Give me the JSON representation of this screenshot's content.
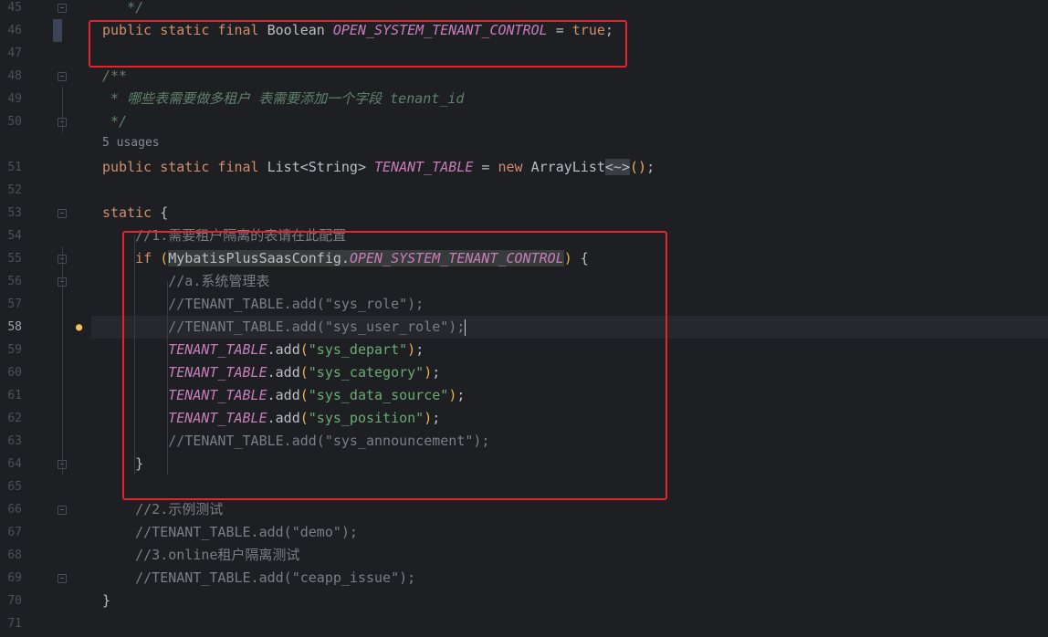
{
  "editor": {
    "current_line": "58",
    "usages_label": "5 usages",
    "lines": [
      {
        "no": "45",
        "tokens": [
          {
            "t": "   */",
            "c": "doc"
          }
        ]
      },
      {
        "no": "46",
        "tokens": [
          {
            "t": "public static final ",
            "c": "kw"
          },
          {
            "t": "Boolean ",
            "c": "type"
          },
          {
            "t": "OPEN_SYSTEM_TENANT_CONTROL",
            "c": "const"
          },
          {
            "t": " = ",
            "c": "type"
          },
          {
            "t": "true",
            "c": "kw"
          },
          {
            "t": ";",
            "c": "type"
          }
        ]
      },
      {
        "no": "47",
        "tokens": []
      },
      {
        "no": "48",
        "tokens": [
          {
            "t": "/**",
            "c": "doc"
          }
        ]
      },
      {
        "no": "49",
        "tokens": [
          {
            "t": " * 哪些表需要做多租户 表需要添加一个字段 ",
            "c": "doc"
          },
          {
            "t": "tenant_id",
            "c": "doc"
          }
        ]
      },
      {
        "no": "50",
        "tokens": [
          {
            "t": " */",
            "c": "doc"
          }
        ]
      },
      {
        "no": "51",
        "tokens": [
          {
            "t": "public static final ",
            "c": "kw"
          },
          {
            "t": "List",
            "c": "type"
          },
          {
            "t": "<",
            "c": "type"
          },
          {
            "t": "String",
            "c": "type"
          },
          {
            "t": "> ",
            "c": "type"
          },
          {
            "t": "TENANT_TABLE",
            "c": "const"
          },
          {
            "t": " = ",
            "c": "type"
          },
          {
            "t": "new ",
            "c": "kw"
          },
          {
            "t": "ArrayList",
            "c": "type"
          },
          {
            "t": "<~>",
            "c": "diamond"
          },
          {
            "t": "()",
            "c": "brace-y"
          },
          {
            "t": ";",
            "c": "type"
          }
        ]
      },
      {
        "no": "52",
        "tokens": []
      },
      {
        "no": "53",
        "tokens": [
          {
            "t": "static ",
            "c": "kw"
          },
          {
            "t": "{",
            "c": "type"
          }
        ]
      },
      {
        "no": "54",
        "tokens": [
          {
            "t": "    //1.需要租户隔离的表请在此配置",
            "c": "cmt"
          }
        ]
      },
      {
        "no": "55",
        "tokens": [
          {
            "t": "    ",
            "c": "type"
          },
          {
            "t": "if ",
            "c": "kw"
          },
          {
            "t": "(",
            "c": "brace-y"
          },
          {
            "t": "MybatisPlusSaasConfig",
            "c": "ref-hl"
          },
          {
            "t": ".",
            "c": "ref-hl"
          },
          {
            "t": "OPEN_SYSTEM_TENANT_CONTROL",
            "c": "ref-hl const"
          },
          {
            "t": ")",
            "c": "brace-y"
          },
          {
            "t": " {",
            "c": "type"
          }
        ]
      },
      {
        "no": "56",
        "tokens": [
          {
            "t": "        //a.系统管理表",
            "c": "cmt"
          }
        ]
      },
      {
        "no": "57",
        "tokens": [
          {
            "t": "        //TENANT_TABLE.add(\"sys_role\");",
            "c": "cmt"
          }
        ]
      },
      {
        "no": "58",
        "tokens": [
          {
            "t": "        //TENANT_TABLE.add(\"sys_user_role\");",
            "c": "cmt"
          }
        ]
      },
      {
        "no": "59",
        "tokens": [
          {
            "t": "        ",
            "c": "type"
          },
          {
            "t": "TENANT_TABLE",
            "c": "const"
          },
          {
            "t": ".add",
            "c": "type"
          },
          {
            "t": "(",
            "c": "brace-y"
          },
          {
            "t": "\"sys_depart\"",
            "c": "str"
          },
          {
            "t": ")",
            "c": "brace-y"
          },
          {
            "t": ";",
            "c": "type"
          }
        ]
      },
      {
        "no": "60",
        "tokens": [
          {
            "t": "        ",
            "c": "type"
          },
          {
            "t": "TENANT_TABLE",
            "c": "const"
          },
          {
            "t": ".add",
            "c": "type"
          },
          {
            "t": "(",
            "c": "brace-y"
          },
          {
            "t": "\"sys_category\"",
            "c": "str"
          },
          {
            "t": ")",
            "c": "brace-y"
          },
          {
            "t": ";",
            "c": "type"
          }
        ]
      },
      {
        "no": "61",
        "tokens": [
          {
            "t": "        ",
            "c": "type"
          },
          {
            "t": "TENANT_TABLE",
            "c": "const"
          },
          {
            "t": ".add",
            "c": "type"
          },
          {
            "t": "(",
            "c": "brace-y"
          },
          {
            "t": "\"sys_data_source\"",
            "c": "str"
          },
          {
            "t": ")",
            "c": "brace-y"
          },
          {
            "t": ";",
            "c": "type"
          }
        ]
      },
      {
        "no": "62",
        "tokens": [
          {
            "t": "        ",
            "c": "type"
          },
          {
            "t": "TENANT_TABLE",
            "c": "const"
          },
          {
            "t": ".add",
            "c": "type"
          },
          {
            "t": "(",
            "c": "brace-y"
          },
          {
            "t": "\"sys_position\"",
            "c": "str"
          },
          {
            "t": ")",
            "c": "brace-y"
          },
          {
            "t": ";",
            "c": "type"
          }
        ]
      },
      {
        "no": "63",
        "tokens": [
          {
            "t": "        //TENANT_TABLE.add(\"sys_announcement\");",
            "c": "cmt"
          }
        ]
      },
      {
        "no": "64",
        "tokens": [
          {
            "t": "    }",
            "c": "type"
          }
        ]
      },
      {
        "no": "65",
        "tokens": []
      },
      {
        "no": "66",
        "tokens": [
          {
            "t": "    //2.示例测试",
            "c": "cmt"
          }
        ]
      },
      {
        "no": "67",
        "tokens": [
          {
            "t": "    //TENANT_TABLE.add(\"demo\");",
            "c": "cmt"
          }
        ]
      },
      {
        "no": "68",
        "tokens": [
          {
            "t": "    //3.online租户隔离测试",
            "c": "cmt"
          }
        ]
      },
      {
        "no": "69",
        "tokens": [
          {
            "t": "    //TENANT_TABLE.add(\"ceapp_issue\");",
            "c": "cmt"
          }
        ]
      },
      {
        "no": "70",
        "tokens": [
          {
            "t": "}",
            "c": "type"
          }
        ]
      },
      {
        "no": "71",
        "tokens": []
      }
    ]
  },
  "colors": {
    "background": "#1e1f22",
    "highlight_box": "#e3242b",
    "keyword": "#cf8e6d",
    "constant": "#c77dbb",
    "string": "#6aab73",
    "comment": "#7a7e85",
    "doc_comment": "#5f826b"
  },
  "icons": {
    "fold": "fold-toggle-icon",
    "intention": "lightbulb-icon"
  }
}
